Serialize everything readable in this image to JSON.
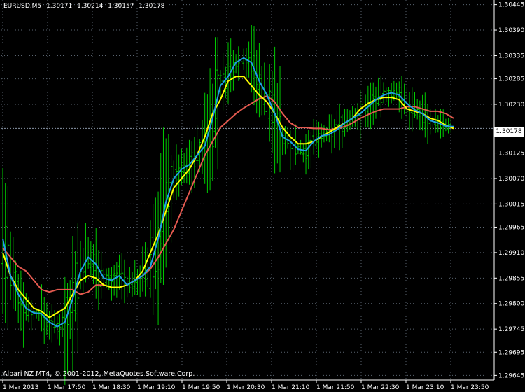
{
  "header": {
    "symbol": "EURUSD,M5",
    "open": "1.30171",
    "high": "1.30214",
    "low": "1.30157",
    "close": "1.30178"
  },
  "copyright": "Alpari NZ MT4, © 2001-2012, MetaQuotes Software Corp.",
  "current_price": "1.30178",
  "colors": {
    "background": "#000000",
    "grid": "#5a6470",
    "candle": "#00cc00",
    "ma_fast": "#1ea0e6",
    "ma_mid": "#ffff00",
    "ma_slow": "#e55a50",
    "bid_line": "#8a96a8"
  },
  "chart_data": {
    "type": "line",
    "symbol": "EURUSD",
    "timeframe": "M5",
    "y_ticks": [
      "1.30445",
      "1.30390",
      "1.30335",
      "1.30285",
      "1.30230",
      "1.30178",
      "1.30125",
      "1.30070",
      "1.30015",
      "1.29965",
      "1.29910",
      "1.29855",
      "1.29800",
      "1.29745",
      "1.29695",
      "1.29645"
    ],
    "x_ticks": [
      "1 Mar 2013",
      "1 Mar 17:50",
      "1 Mar 18:30",
      "1 Mar 19:10",
      "1 Mar 19:50",
      "1 Mar 20:30",
      "1 Mar 21:10",
      "1 Mar 21:50",
      "1 Mar 22:30",
      "1 Mar 23:10",
      "1 Mar 23:50"
    ],
    "ylim": [
      1.29635,
      1.30455
    ],
    "grid": true,
    "series": [
      {
        "color": "#1ea0e6",
        "values": [
          1.2994,
          1.2986,
          1.2982,
          1.2979,
          1.2978,
          1.29778,
          1.2976,
          1.2975,
          1.2976,
          1.2981,
          1.2987,
          1.299,
          1.29885,
          1.29855,
          1.2985,
          1.2986,
          1.2984,
          1.2985,
          1.2986,
          1.2988,
          1.2994,
          1.3002,
          1.3007,
          1.3009,
          1.301,
          1.3012,
          1.3014,
          1.302,
          1.3027,
          1.3029,
          1.3032,
          1.3033,
          1.3032,
          1.3028,
          1.3025,
          1.3021,
          1.3016,
          1.3015,
          1.30133,
          1.3013,
          1.3015,
          1.30162,
          1.30165,
          1.30175,
          1.3019,
          1.302,
          1.3021,
          1.30225,
          1.3024,
          1.3025,
          1.30255,
          1.3025,
          1.30232,
          1.30218,
          1.3021,
          1.30195,
          1.3019,
          1.30183,
          1.30182
        ]
      },
      {
        "color": "#ffff00",
        "values": [
          1.2991,
          1.2986,
          1.2983,
          1.2981,
          1.2979,
          1.29783,
          1.2977,
          1.2978,
          1.2979,
          1.2982,
          1.2985,
          1.2986,
          1.29855,
          1.2984,
          1.29835,
          1.29835,
          1.2984,
          1.2985,
          1.2987,
          1.2991,
          1.2995,
          1.3,
          1.3005,
          1.3007,
          1.3009,
          1.3012,
          1.3016,
          1.3021,
          1.3024,
          1.3028,
          1.3029,
          1.3029,
          1.3027,
          1.3025,
          1.30235,
          1.3021,
          1.3018,
          1.3016,
          1.30145,
          1.30145,
          1.3015,
          1.3016,
          1.3017,
          1.3018,
          1.3019,
          1.302,
          1.3022,
          1.30232,
          1.3024,
          1.30245,
          1.30245,
          1.3024,
          1.3022,
          1.30215,
          1.3021,
          1.302,
          1.30195,
          1.30185,
          1.30178
        ]
      },
      {
        "color": "#e55a50",
        "values": [
          1.2992,
          1.299,
          1.2988,
          1.2987,
          1.2985,
          1.2983,
          1.29825,
          1.2983,
          1.2983,
          1.2983,
          1.2982,
          1.29825,
          1.2984,
          1.2984,
          1.29835,
          1.29835,
          1.2984,
          1.2985,
          1.2986,
          1.29875,
          1.299,
          1.2993,
          1.2996,
          1.3,
          1.3004,
          1.3008,
          1.3012,
          1.3015,
          1.3018,
          1.30195,
          1.3021,
          1.30222,
          1.30232,
          1.30242,
          1.30248,
          1.30235,
          1.3021,
          1.3019,
          1.3018,
          1.3018,
          1.30178,
          1.30178,
          1.30175,
          1.30178,
          1.30182,
          1.3019,
          1.302,
          1.30208,
          1.30215,
          1.3022,
          1.3022,
          1.3022,
          1.30225,
          1.30225,
          1.3022,
          1.30215,
          1.30215,
          1.3021,
          1.302
        ]
      }
    ]
  }
}
